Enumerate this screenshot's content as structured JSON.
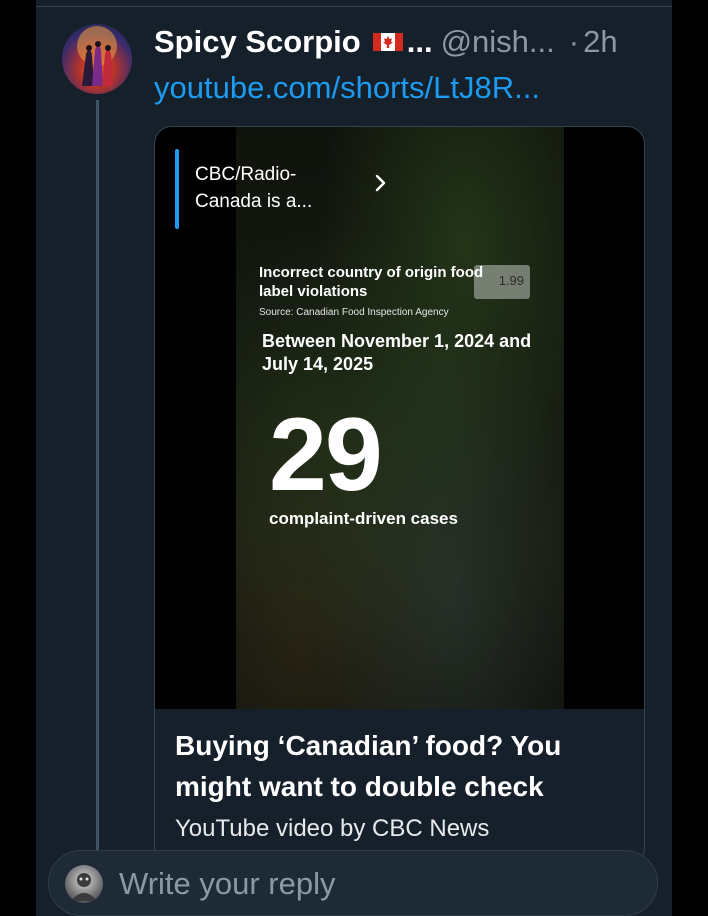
{
  "tweet": {
    "display_name": "Spicy Scorpio",
    "flag_icon": "canada-flag-icon",
    "name_ellipsis": "...",
    "handle": "@nish...",
    "separator": "·",
    "timestamp": "2h",
    "link_text": "youtube.com/shorts/LtJ8R..."
  },
  "card": {
    "channel_name": "CBC/Radio-Canada is a...",
    "overlay": {
      "heading": "Incorrect country of origin food label violations",
      "source": "Source: Canadian Food Inspection Agency",
      "dates": "Between November 1, 2024 and July 14, 2025",
      "number": "29",
      "caption": "complaint-driven cases",
      "price_tag": "1.99"
    },
    "title": "Buying ‘Canadian’ food? You might want to double check",
    "subtitle": "YouTube video by CBC News"
  },
  "reply": {
    "placeholder": "Write your reply"
  },
  "colors": {
    "background": "#15202b",
    "link": "#1d9bf0",
    "muted": "#8b98a5",
    "accent_bar": "#1d9bf0"
  }
}
